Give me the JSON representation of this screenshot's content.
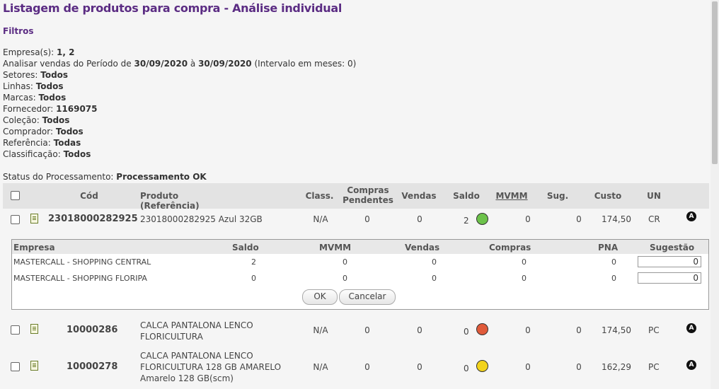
{
  "page": {
    "title": "Listagem de produtos para compra - Análise individual",
    "filters_title": "Filtros"
  },
  "filters": {
    "empresas_label": "Empresa(s):",
    "empresas_value": "1, 2",
    "periodo_label": "Analisar vendas do Período de",
    "periodo_start": "30/09/2020",
    "periodo_sep": "à",
    "periodo_end": "30/09/2020",
    "periodo_note": "(Intervalo em meses: 0)",
    "setores_label": "Setores:",
    "setores_value": "Todos",
    "linhas_label": "Linhas:",
    "linhas_value": "Todos",
    "marcas_label": "Marcas:",
    "marcas_value": "Todos",
    "fornecedor_label": "Fornecedor:",
    "fornecedor_value": "1169075",
    "colecao_label": "Coleção:",
    "colecao_value": "Todos",
    "comprador_label": "Comprador:",
    "comprador_value": "Todos",
    "referencia_label": "Referência:",
    "referencia_value": "Todas",
    "classificacao_label": "Classificação:",
    "classificacao_value": "Todos",
    "status_label": "Status do Processamento:",
    "status_value": "Processamento OK"
  },
  "table": {
    "headers": {
      "cod": "Cód",
      "produto": "Produto (Referência)",
      "class": "Class.",
      "compras_pend_1": "Compras",
      "compras_pend_2": "Pendentes",
      "vendas": "Vendas",
      "saldo": "Saldo",
      "mvmm": "MVMM",
      "sug": "Sug.",
      "custo": "Custo",
      "un": "UN"
    },
    "rows": [
      {
        "cod": "23018000282925",
        "produto_1": "23018000282925 Azul 32GB",
        "produto_2": "",
        "produto_3": "",
        "class": "N/A",
        "compras": "0",
        "vendas": "0",
        "saldo": "2",
        "mvmm": "0",
        "sug": "0",
        "custo": "174,50",
        "un": "CR",
        "badge": "A",
        "status_icon": "smile-green-icon",
        "status_color": "#6cc24a"
      },
      {
        "cod": "10000286",
        "produto_1": "CALCA PANTALONA LENCO",
        "produto_2": "FLORICULTURA",
        "produto_3": "",
        "class": "N/A",
        "compras": "0",
        "vendas": "0",
        "saldo": "0",
        "mvmm": "0",
        "sug": "0",
        "custo": "174,50",
        "un": "PC",
        "badge": "A",
        "status_icon": "frown-red-icon",
        "status_color": "#e05a3a"
      },
      {
        "cod": "10000278",
        "produto_1": "CALCA PANTALONA LENCO",
        "produto_2": "FLORICULTURA 128 GB AMARELO",
        "produto_3": "Amarelo 128 GB(scm)",
        "class": "N/A",
        "compras": "0",
        "vendas": "0",
        "saldo": "0",
        "mvmm": "0",
        "sug": "0",
        "custo": "162,29",
        "un": "PC",
        "badge": "A",
        "status_icon": "neutral-yellow-icon",
        "status_color": "#f2d31b"
      }
    ]
  },
  "detail": {
    "headers": {
      "empresa": "Empresa",
      "saldo": "Saldo",
      "mvmm": "MVMM",
      "vendas": "Vendas",
      "compras": "Compras",
      "pna": "PNA",
      "sugestao": "Sugestão"
    },
    "rows": [
      {
        "empresa": "MASTERCALL - SHOPPING CENTRAL",
        "saldo": "2",
        "mvmm": "0",
        "vendas": "0",
        "compras": "0",
        "pna": "0",
        "sugestao": "0"
      },
      {
        "empresa": "MASTERCALL - SHOPPING FLORIPA",
        "saldo": "0",
        "mvmm": "0",
        "vendas": "0",
        "compras": "0",
        "pna": "0",
        "sugestao": "0"
      }
    ],
    "ok_label": "OK",
    "cancel_label": "Cancelar"
  }
}
